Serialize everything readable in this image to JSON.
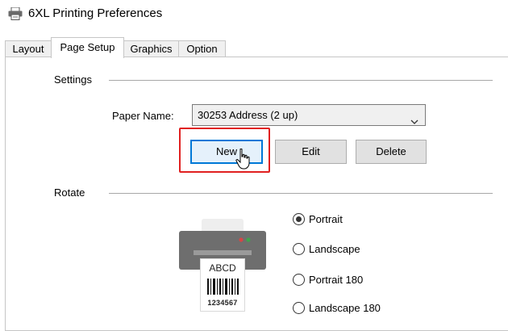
{
  "window": {
    "title": "6XL Printing Preferences"
  },
  "tabs": [
    {
      "label": "Layout"
    },
    {
      "label": "Page Setup"
    },
    {
      "label": "Graphics"
    },
    {
      "label": "Option"
    }
  ],
  "settings": {
    "group_label": "Settings",
    "paper_name_label": "Paper Name:",
    "paper_name_value": "30253 Address (2 up)",
    "buttons": {
      "new": "New",
      "edit": "Edit",
      "delete": "Delete"
    }
  },
  "rotate": {
    "group_label": "Rotate",
    "options": [
      {
        "label": "Portrait",
        "selected": true
      },
      {
        "label": "Landscape",
        "selected": false
      },
      {
        "label": "Portrait 180",
        "selected": false
      },
      {
        "label": "Landscape 180",
        "selected": false
      }
    ],
    "preview": {
      "label_text": "ABCD",
      "label_number": "1234567"
    }
  },
  "colors": {
    "highlight": "#e02020",
    "focus": "#0078d7"
  }
}
